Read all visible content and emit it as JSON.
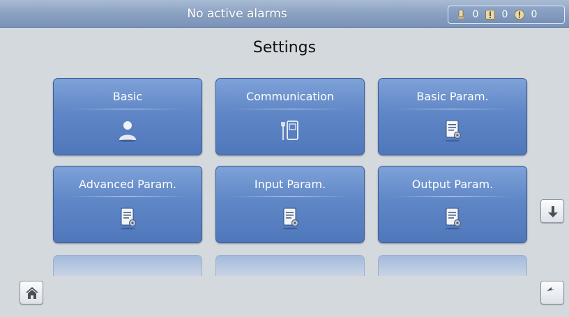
{
  "status_bar": {
    "alarm_text": "No active alarms",
    "counts": [
      {
        "icon": "critical-alarm-icon",
        "value": "0"
      },
      {
        "icon": "major-alarm-icon",
        "value": "0"
      },
      {
        "icon": "minor-alarm-icon",
        "value": "0"
      }
    ]
  },
  "page_title": "Settings",
  "tiles": [
    {
      "label": "Basic",
      "icon": "user-icon"
    },
    {
      "label": "Communication",
      "icon": "communication-icon"
    },
    {
      "label": "Basic Param.",
      "icon": "document-settings-icon"
    },
    {
      "label": "Advanced Param.",
      "icon": "document-settings-icon"
    },
    {
      "label": "Input Param.",
      "icon": "document-settings-icon"
    },
    {
      "label": "Output Param.",
      "icon": "document-settings-icon"
    }
  ],
  "nav": {
    "home": "home-icon",
    "scroll_down": "arrow-down-icon",
    "back": "back-arrow-icon"
  },
  "colors": {
    "tile_blue": "#5f86c6",
    "header_blue": "#8aa1c2",
    "background": "#d4d9de"
  }
}
